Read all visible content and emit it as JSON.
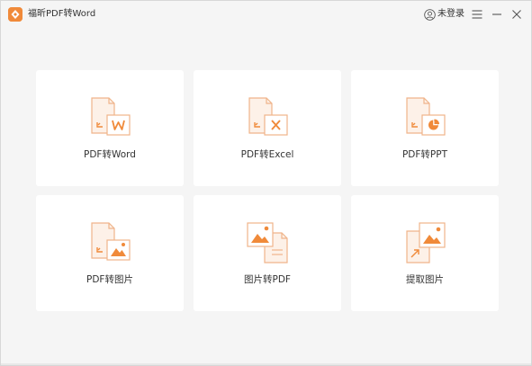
{
  "window": {
    "title": "福昕PDF转Word",
    "logo_icon": "foxit-app-logo-icon",
    "accent_color": "#f08a3a"
  },
  "titlebar": {
    "login_label": "未登录",
    "user_icon": "user-circle-icon",
    "menu_icon": "hamburger-menu-icon",
    "minimize_icon": "minimize-icon",
    "close_icon": "close-icon"
  },
  "cards": [
    {
      "label": "PDF转Word",
      "icon": "pdf-to-word-icon"
    },
    {
      "label": "PDF转Excel",
      "icon": "pdf-to-excel-icon"
    },
    {
      "label": "PDF转PPT",
      "icon": "pdf-to-ppt-icon"
    },
    {
      "label": "PDF转图片",
      "icon": "pdf-to-image-icon"
    },
    {
      "label": "图片转PDF",
      "icon": "image-to-pdf-icon"
    },
    {
      "label": "提取图片",
      "icon": "extract-image-icon"
    }
  ]
}
